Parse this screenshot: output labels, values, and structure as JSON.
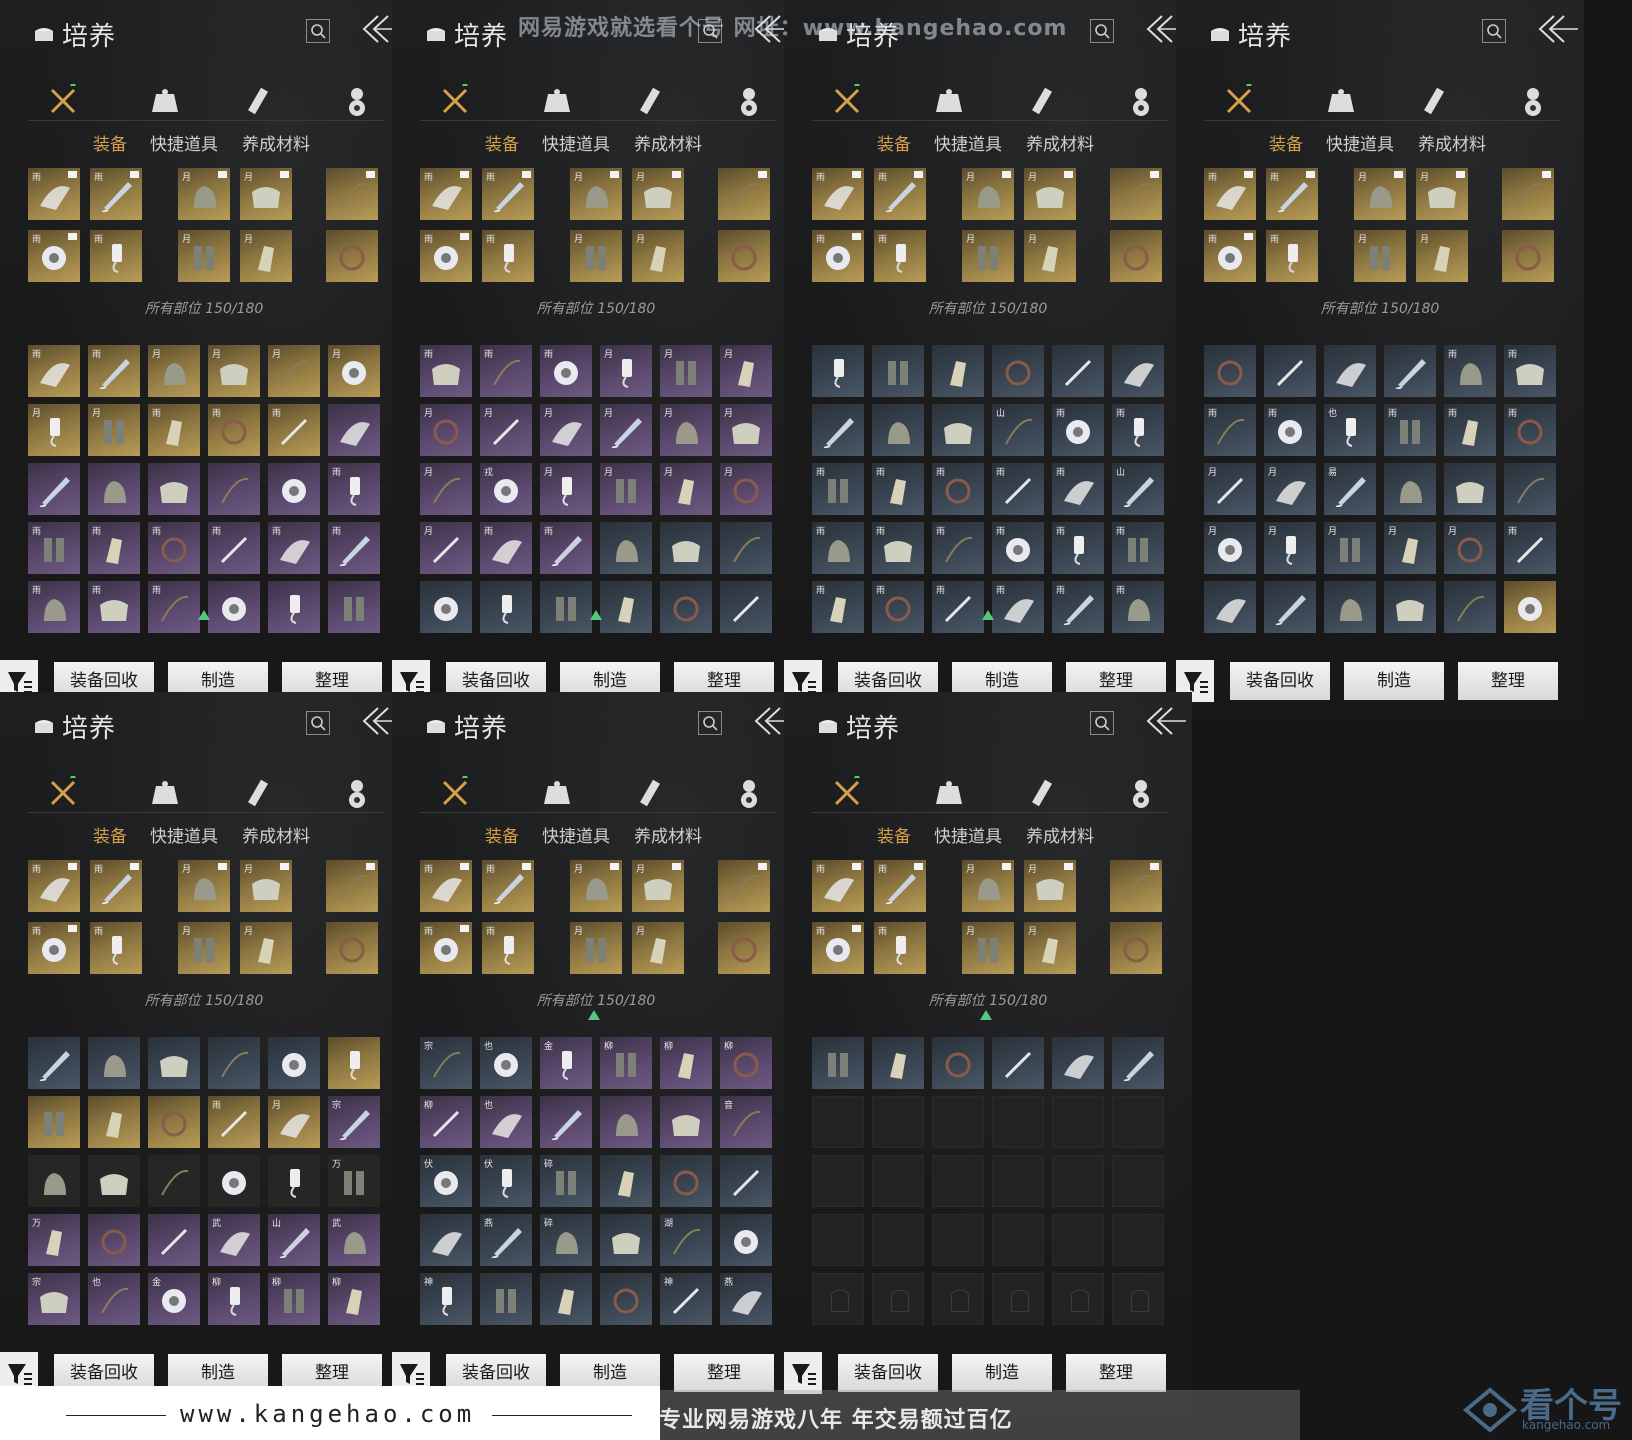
{
  "panel_common": {
    "title": "培养",
    "subtabs": [
      "装备",
      "快捷道具",
      "养成材料"
    ],
    "count_label": "所有部位 150/180",
    "filter_icon": "filter-icon",
    "buttons": [
      "装备回收",
      "制造",
      "整理"
    ]
  },
  "equipped": {
    "row1": [
      {
        "glyph": "雨",
        "kind": "fan",
        "tag": true
      },
      {
        "glyph": "雨",
        "kind": "umbrella",
        "tag": true
      },
      {
        "glyph": "月",
        "kind": "helmet",
        "tag": true
      },
      {
        "glyph": "月",
        "kind": "armor",
        "tag": true
      },
      {
        "glyph": "",
        "kind": "bow",
        "tag": true
      }
    ],
    "row2": [
      {
        "glyph": "雨",
        "kind": "ring",
        "tag": true
      },
      {
        "glyph": "雨",
        "kind": "jade",
        "tag": false
      },
      {
        "glyph": "月",
        "kind": "greaves",
        "tag": false
      },
      {
        "glyph": "月",
        "kind": "bracer",
        "tag": false
      },
      {
        "glyph": "",
        "kind": "necklace",
        "tag": false
      }
    ]
  },
  "panels": [
    {
      "id": "p1",
      "rows": [
        [
          "g雨",
          "g雨",
          "g月",
          "g月",
          "g月",
          "g月"
        ],
        [
          "g月",
          "g月",
          "g雨",
          "g雨",
          "g雨",
          "p"
        ],
        [
          "p",
          "p",
          "p",
          "p",
          "p",
          "p雨"
        ],
        [
          "p雨",
          "p雨",
          "p雨",
          "p雨",
          "p雨",
          "p雨"
        ],
        [
          "p雨",
          "p雨",
          "p雨",
          "p",
          "p",
          "p"
        ]
      ],
      "marker": true
    },
    {
      "id": "p2",
      "rows": [
        [
          "p雨",
          "p雨",
          "p雨",
          "p月",
          "p月",
          "p月"
        ],
        [
          "p月",
          "p月",
          "p月",
          "p月",
          "p月",
          "p月"
        ],
        [
          "p月",
          "p戎",
          "p月",
          "p月",
          "p月",
          "p月"
        ],
        [
          "p月",
          "p雨",
          "p雨",
          "b",
          "b",
          "b"
        ],
        [
          "b",
          "b",
          "b",
          "b",
          "b",
          "b"
        ]
      ],
      "marker": true
    },
    {
      "id": "p3",
      "rows": [
        [
          "b",
          "b",
          "b",
          "b",
          "b",
          "b"
        ],
        [
          "b",
          "b",
          "b",
          "b山",
          "b雨",
          "b雨"
        ],
        [
          "b雨",
          "b雨",
          "b雨",
          "b雨",
          "b雨",
          "b山"
        ],
        [
          "b雨",
          "b雨",
          "b雨",
          "b雨",
          "b雨",
          "b雨"
        ],
        [
          "b雨",
          "b雨",
          "b雨",
          "b雨",
          "b雨",
          "b雨"
        ]
      ],
      "marker": true
    },
    {
      "id": "p4",
      "rows": [
        [
          "b",
          "b",
          "b",
          "b",
          "b雨",
          "b雨"
        ],
        [
          "b雨",
          "b雨",
          "b也",
          "b雨",
          "b雨",
          "b雨"
        ],
        [
          "b月",
          "b月",
          "b易",
          "b",
          "b",
          "b"
        ],
        [
          "b月",
          "b月",
          "b月",
          "b月",
          "b月",
          "b雨"
        ],
        [
          "b",
          "b",
          "b",
          "b",
          "b",
          "g"
        ]
      ],
      "marker": false
    },
    {
      "id": "p5",
      "rows": [
        [
          "b",
          "b",
          "b",
          "b",
          "b",
          "g"
        ],
        [
          "g",
          "g",
          "g",
          "g雨",
          "g月",
          "p宗"
        ],
        [
          "d",
          "d",
          "d",
          "d",
          "d",
          "d万"
        ],
        [
          "p万",
          "p",
          "p",
          "p武",
          "p山",
          "p武"
        ],
        [
          "p宗",
          "p也",
          "p金",
          "p柳",
          "p柳",
          "p柳"
        ]
      ],
      "marker": false
    },
    {
      "id": "p6",
      "rows": [
        [
          "b宗",
          "b也",
          "p金",
          "p柳",
          "p柳",
          "p柳"
        ],
        [
          "p柳",
          "p也",
          "p",
          "p",
          "p",
          "p音"
        ],
        [
          "b伏",
          "b伏",
          "b碎",
          "b",
          "b",
          "b"
        ],
        [
          "b",
          "b燕",
          "b碎",
          "b",
          "b湖",
          "b"
        ],
        [
          "b神",
          "b",
          "b",
          "b",
          "b神",
          "b燕"
        ]
      ],
      "marker": true
    },
    {
      "id": "p7",
      "rows": [
        [
          "b",
          "b",
          "b",
          "b",
          "b",
          "b"
        ],
        [
          "e",
          "e",
          "e",
          "e",
          "e",
          "e"
        ],
        [
          "e",
          "e",
          "e",
          "e",
          "e",
          "e"
        ],
        [
          "e",
          "e",
          "e",
          "e",
          "e",
          "e"
        ],
        [
          "e",
          "e",
          "e",
          "e",
          "e",
          "e"
        ]
      ],
      "marker": true
    }
  ],
  "watermarks": {
    "top": "网易游戏就选看个号    网址：www.kangehao.com",
    "bottom": "看个号专业网易游戏八年    年交易额过百亿",
    "site": "www.kangehao.com",
    "logo": "看个号",
    "logo_sub": "kangehao.com"
  },
  "colors": {
    "active_tab": "#d7a14a",
    "gold": "#b89c57",
    "purple": "#6d5a80",
    "blue": "#4a5764",
    "marker": "#57c97e"
  }
}
